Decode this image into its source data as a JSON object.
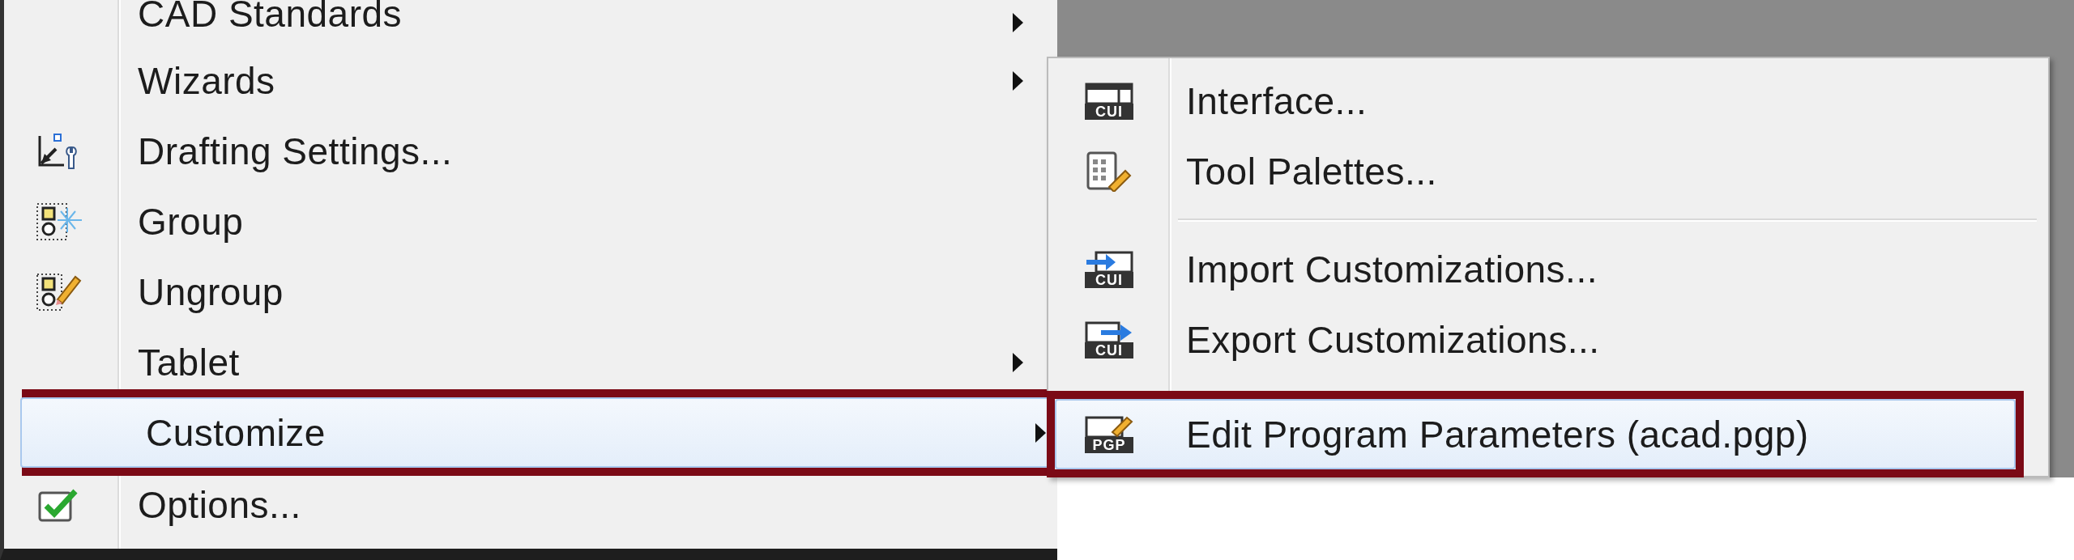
{
  "menu": {
    "items": [
      {
        "label": "CAD Standards",
        "has_submenu": true,
        "selected": false,
        "highlighted": false
      },
      {
        "label": "Wizards",
        "has_submenu": true,
        "selected": false,
        "highlighted": false
      },
      {
        "label": "Drafting Settings...",
        "has_submenu": false,
        "selected": false,
        "highlighted": false
      },
      {
        "label": "Group",
        "has_submenu": false,
        "selected": false,
        "highlighted": false
      },
      {
        "label": "Ungroup",
        "has_submenu": false,
        "selected": false,
        "highlighted": false
      },
      {
        "label": "Tablet",
        "has_submenu": true,
        "selected": false,
        "highlighted": false
      },
      {
        "label": "Customize",
        "has_submenu": true,
        "selected": true,
        "highlighted": true
      },
      {
        "label": "Options...",
        "has_submenu": false,
        "selected": false,
        "highlighted": false
      }
    ]
  },
  "submenu": {
    "items": [
      {
        "kind": "command",
        "label": "Interface...",
        "icon_text": "CUI",
        "selected": false,
        "highlighted": false
      },
      {
        "kind": "command",
        "label": "Tool Palettes...",
        "selected": false,
        "highlighted": false
      },
      {
        "kind": "separator"
      },
      {
        "kind": "command",
        "label": "Import Customizations...",
        "icon_text": "CUI",
        "selected": false,
        "highlighted": false
      },
      {
        "kind": "command",
        "label": "Export Customizations...",
        "icon_text": "CUI",
        "selected": false,
        "highlighted": false
      },
      {
        "kind": "gap"
      },
      {
        "kind": "command",
        "label": "Edit Program Parameters (acad.pgp)",
        "icon_text": "PGP",
        "selected": true,
        "highlighted": true
      }
    ]
  }
}
